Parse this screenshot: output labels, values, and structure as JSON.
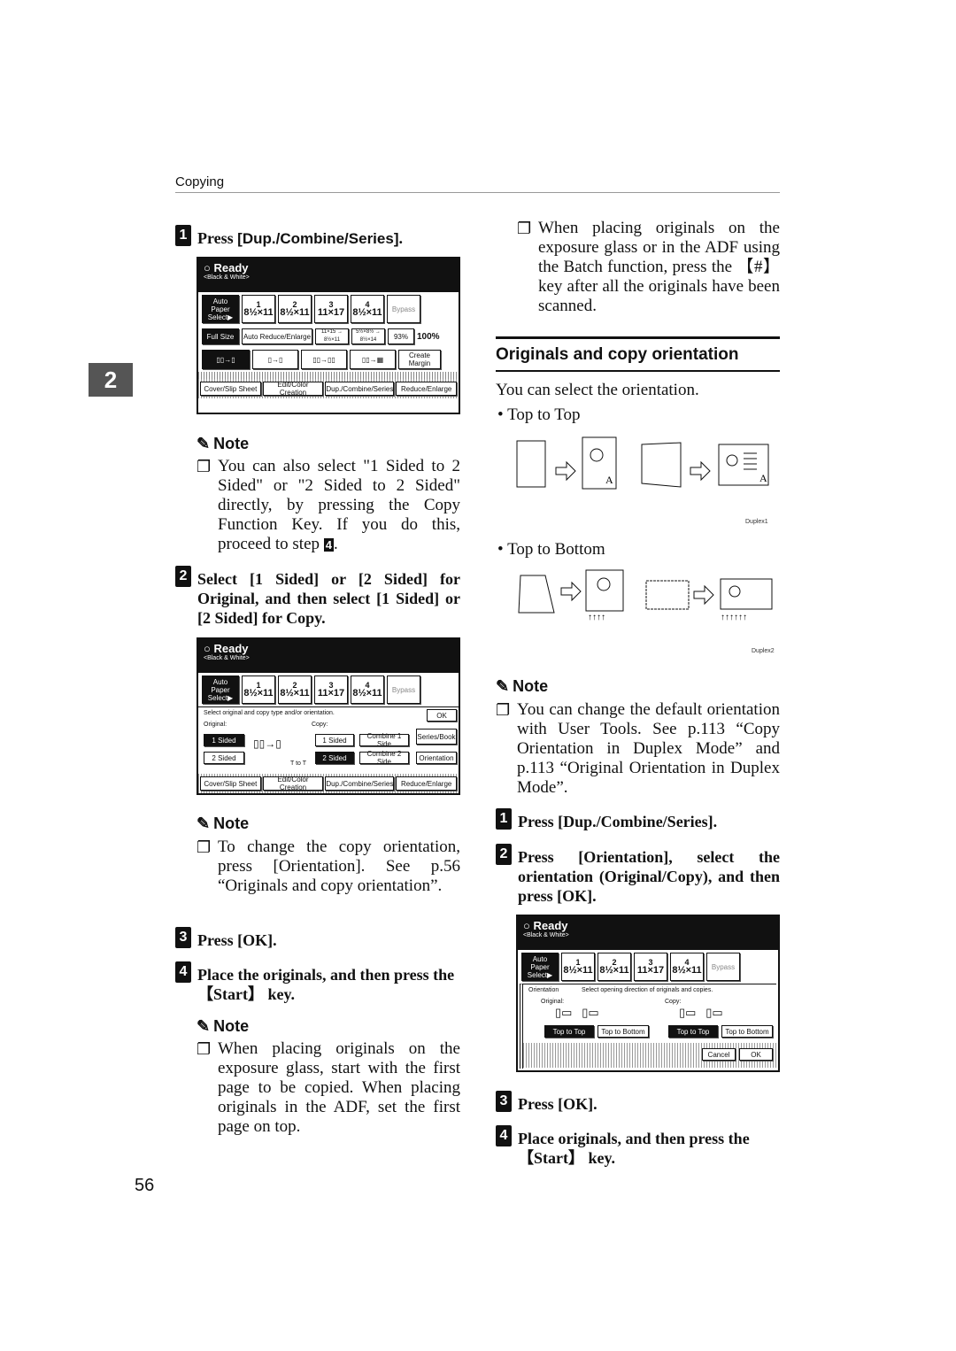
{
  "header": {
    "section": "Copying",
    "chapter_tab": "2",
    "page_number": "56"
  },
  "left": {
    "step1": {
      "num": "1",
      "pre": "Press ",
      "key": "[Dup./Combine/Series]",
      "post": "."
    },
    "panel1": {
      "ready": "Ready",
      "mode": "<Black & White>",
      "auto_paper": "Auto Paper Select▶",
      "trays": [
        {
          "t": "1",
          "s": "8½×11"
        },
        {
          "t": "2",
          "s": "8½×11"
        },
        {
          "t": "3",
          "s": "11×17"
        },
        {
          "t": "4",
          "s": "8½×11"
        }
      ],
      "bypass": "Bypass",
      "full_size": "Full Size",
      "auto_reduce": "Auto Reduce/Enlarge",
      "r1": "11×15 → 8½×11",
      "r2": "5½×8½ → 8½×14",
      "ratio": "93%",
      "zoom": "100%",
      "create_margin": "Create Margin",
      "tabs": [
        "Cover/Slip Sheet",
        "Edit/Color Creation",
        "Dup./Combine/Series",
        "Reduce/Enlarge"
      ]
    },
    "note1": {
      "title": "Note",
      "text": "You can also select \"1 Sided to 2 Sided\" or \"2 Sided to 2 Sided\" directly, by pressing the Copy Function Key. If you do this, proceed to step ",
      "step_ref": "4",
      "end": "."
    },
    "step2": {
      "num": "2",
      "text": "Select [1 Sided] or [2 Sided] for Original, and then select [1 Sided] or [2 Sided] for Copy."
    },
    "panel2": {
      "instruction": "Select original and copy type and/or orientation.",
      "ok": "OK",
      "original": "Original:",
      "copy": "Copy:",
      "orig_1": "1 Sided",
      "orig_2": "2 Sided",
      "copy_1": "1 Sided",
      "copy_2": "2 Sided",
      "comb1": "Combine 1 Side",
      "comb2": "Combine 2 Side",
      "series": "Series/Book",
      "orientation": "Orientation",
      "t_to_t": "T to T"
    },
    "note2": {
      "title": "Note",
      "text": "To change the copy orientation, press [Orientation]. See p.56 “Originals and copy orientation”."
    },
    "step3": {
      "num": "3",
      "text": "Press [OK]."
    },
    "step4": {
      "num": "4",
      "text": "Place the originals, and then press the 【Start】 key."
    },
    "note3": {
      "title": "Note",
      "text": "When placing originals on the exposure glass, start with the first page to be copied. When placing originals in the ADF, set the first page on top."
    }
  },
  "right": {
    "note_cont": "When placing originals on the exposure glass or in the ADF using the Batch function, press the 【#】 key after all the originals have been scanned.",
    "section_title": "Originals and copy orientation",
    "intro": "You can select the orientation.",
    "bullet1": "Top to Top",
    "diagram1": "Duplex1",
    "bullet2": "Top to Bottom",
    "diagram2": "Duplex2",
    "note": {
      "title": "Note",
      "text": "You can change the default orientation with User Tools. See p.113 “Copy Orientation in Duplex Mode” and p.113 “Original Orientation in Duplex Mode”."
    },
    "step1": {
      "num": "1",
      "text": "Press [Dup./Combine/Series]."
    },
    "step2": {
      "num": "2",
      "text": "Press [Orientation], select the orientation (Original/Copy), and then press [OK]."
    },
    "panel3": {
      "title": "Orientation",
      "instruction": "Select opening direction of originals and copies.",
      "original": "Original:",
      "copy": "Copy:",
      "ttt": "Top to Top",
      "ttb": "Top to Bottom",
      "cancel": "Cancel",
      "ok": "OK"
    },
    "step3": {
      "num": "3",
      "text": "Press [OK]."
    },
    "step4": {
      "num": "4",
      "text": "Place originals, and then press the 【Start】 key."
    }
  }
}
